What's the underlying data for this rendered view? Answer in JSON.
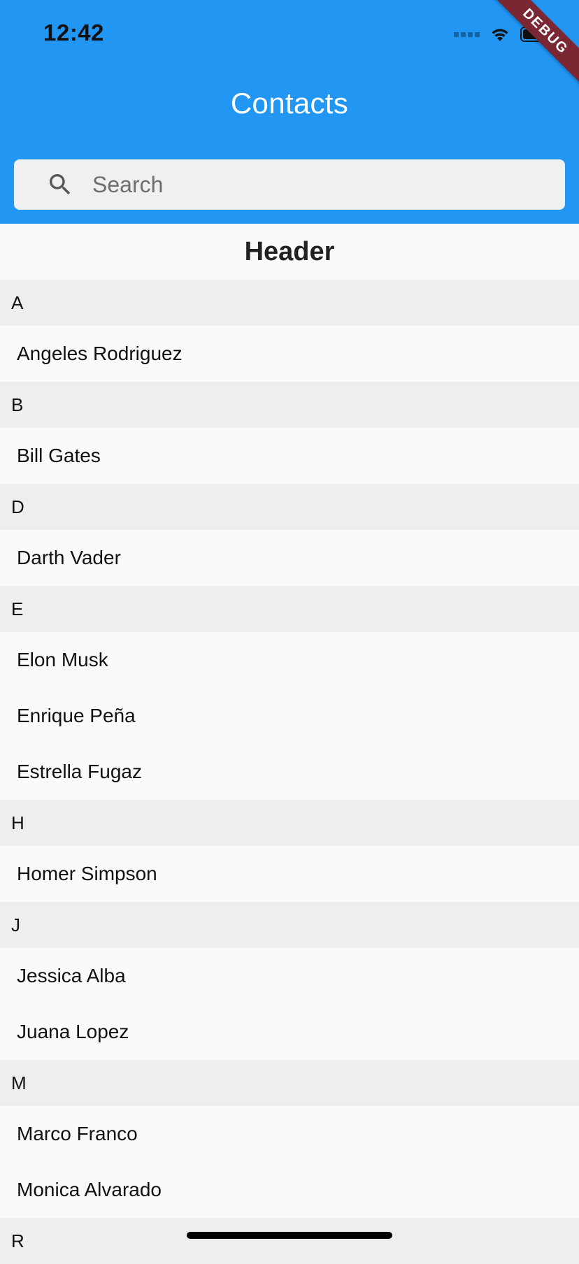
{
  "status_bar": {
    "time": "12:42"
  },
  "debug_banner": "DEBUG",
  "app_bar": {
    "title": "Contacts",
    "color": "#2196f3"
  },
  "search": {
    "placeholder": "Search",
    "value": "",
    "icon": "search-icon"
  },
  "list": {
    "header": "Header",
    "sections": [
      {
        "letter": "A",
        "contacts": [
          "Angeles Rodriguez"
        ]
      },
      {
        "letter": "B",
        "contacts": [
          "Bill Gates"
        ]
      },
      {
        "letter": "D",
        "contacts": [
          "Darth Vader"
        ]
      },
      {
        "letter": "E",
        "contacts": [
          "Elon Musk",
          "Enrique Peña",
          "Estrella Fugaz"
        ]
      },
      {
        "letter": "H",
        "contacts": [
          "Homer Simpson"
        ]
      },
      {
        "letter": "J",
        "contacts": [
          "Jessica Alba",
          "Juana Lopez"
        ]
      },
      {
        "letter": "M",
        "contacts": [
          "Marco Franco",
          "Monica Alvarado"
        ]
      },
      {
        "letter": "R",
        "contacts": []
      }
    ]
  }
}
